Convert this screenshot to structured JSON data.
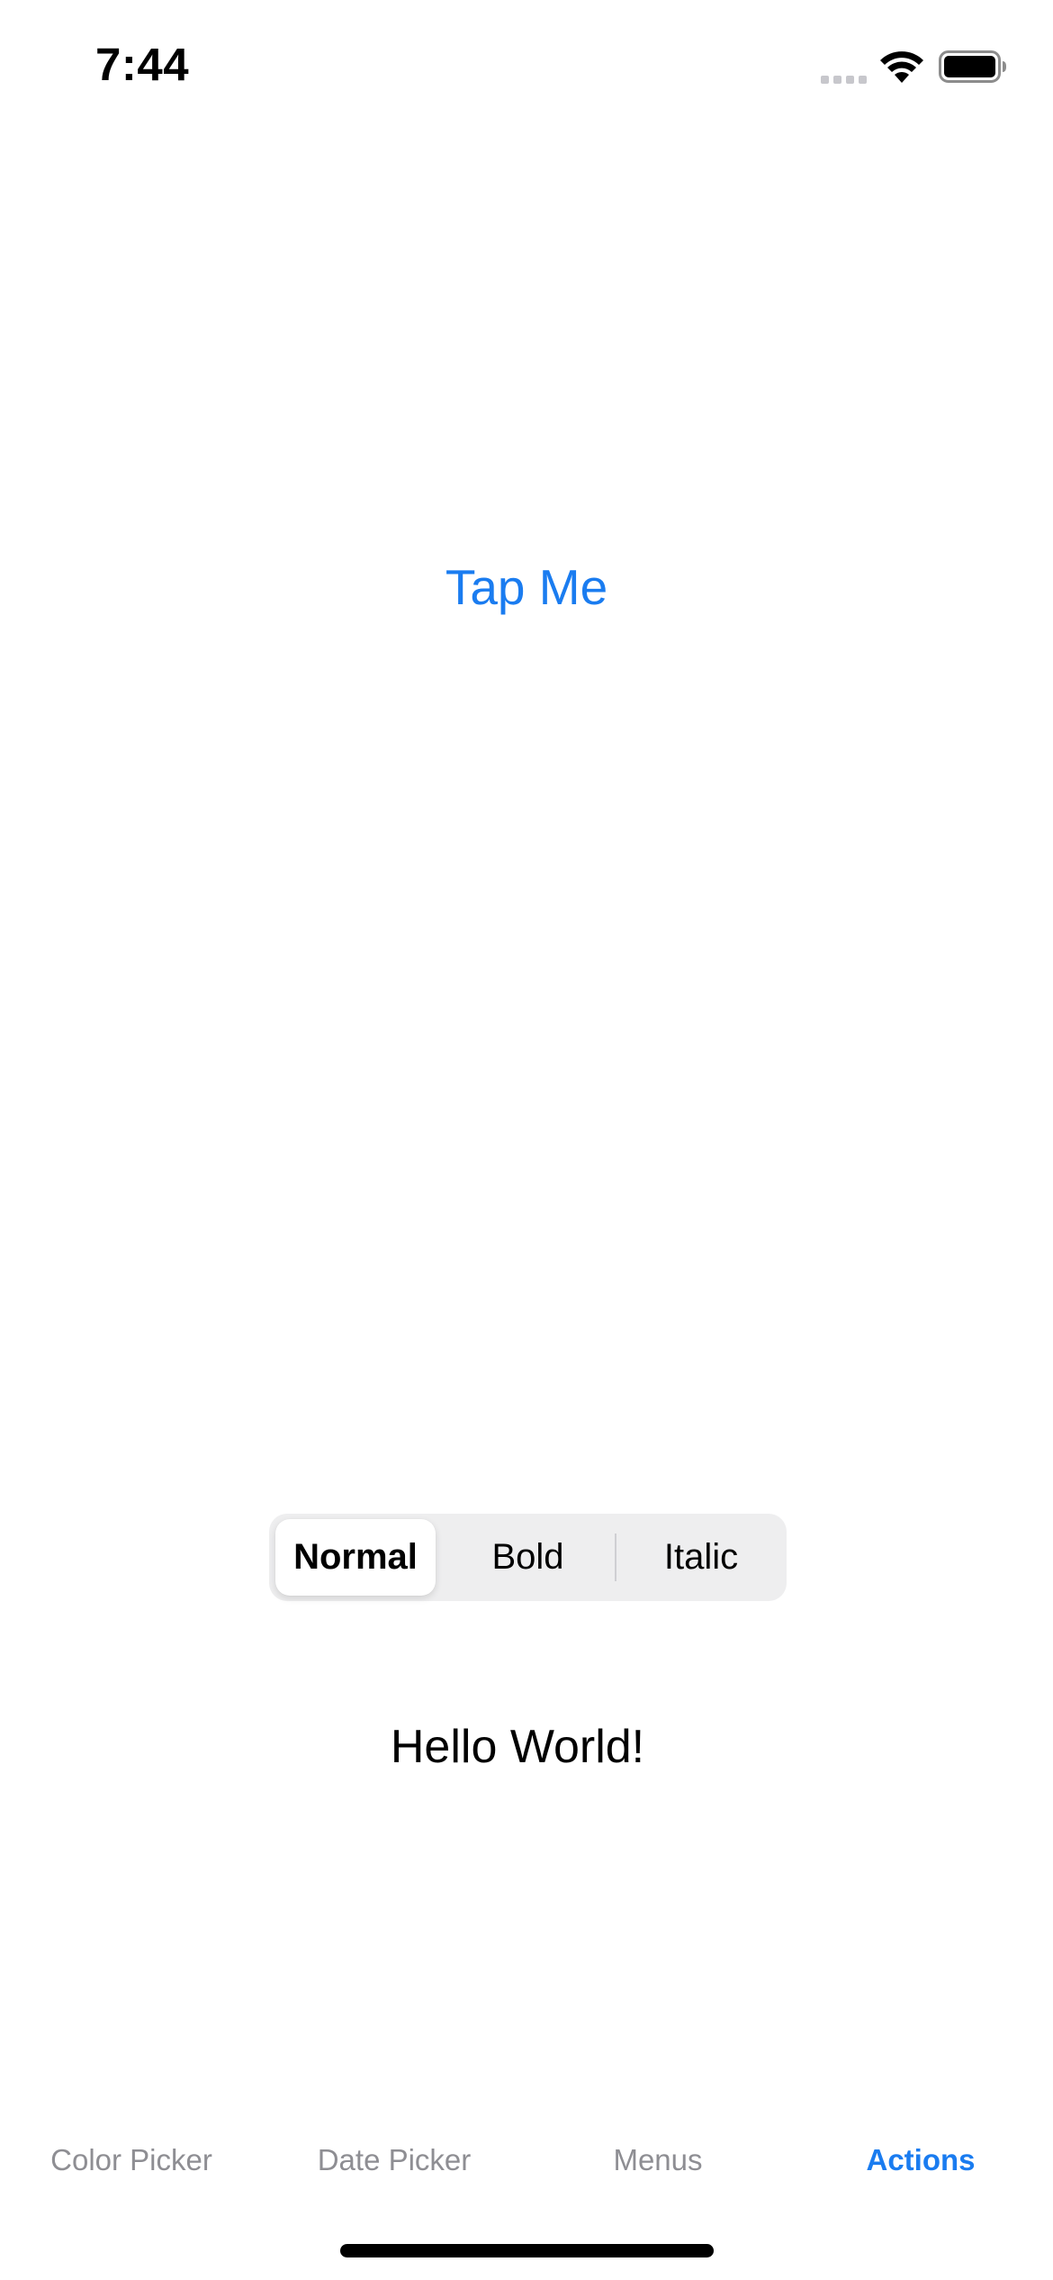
{
  "status_bar": {
    "time": "7:44"
  },
  "main": {
    "button_label": "Tap Me",
    "segmented": {
      "options": [
        "Normal",
        "Bold",
        "Italic"
      ],
      "selected": "Normal"
    },
    "preview_text": "Hello World!"
  },
  "tab_bar": {
    "items": [
      {
        "label": "Color Picker"
      },
      {
        "label": "Date Picker"
      },
      {
        "label": "Menus"
      },
      {
        "label": "Actions"
      }
    ],
    "active": "Actions"
  },
  "colors": {
    "accent": "#1a7cf0",
    "inactive_tab": "#8e8e93",
    "segment_bg": "#eeeeef"
  }
}
